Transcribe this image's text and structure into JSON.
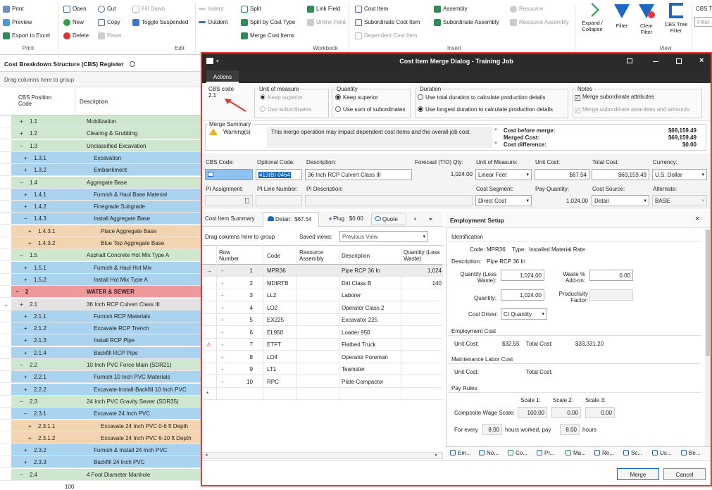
{
  "ribbon": {
    "print": "Print",
    "preview": "Preview",
    "export": "Export to Excel",
    "group_print": "Print",
    "open": "Open",
    "new": "New",
    "delete": "Delete",
    "cut": "Cut",
    "copy": "Copy",
    "paste": "Paste",
    "fill_down": "Fill Down",
    "toggle_suspended": "Toggle Suspended",
    "group_edit": "Edit",
    "indent": "Indent",
    "outdent": "Outdent",
    "split": "Split",
    "split_by_cost_type": "Split by Cost Type",
    "merge_cost_items": "Merge Cost Items",
    "link_field": "Link Field",
    "unlink_field": "Unlink Field",
    "group_workbook": "Workbook",
    "cost_item": "Cost Item",
    "subordinate_cost_item": "Subordinate Cost Item",
    "dependent_cost_item": "Dependent Cost Item",
    "assembly": "Assembly",
    "subordinate_assembly": "Subordinate Assembly",
    "resource": "Resource",
    "resource_assembly": "Resource Assembly",
    "group_insert": "Insert",
    "expand_collapse": "Expand / Collapse",
    "filter": "Filter",
    "clear_filter": "Clear Filter",
    "cbs_tree_filter": "CBS Tree Filter",
    "group_view": "View",
    "cbs_tr": "CBS Tr",
    "filter_input": "Filter"
  },
  "left_panel": {
    "title": "Cost Breakdown Structure (CBS) Register",
    "drag_hint": "Drag columns here to group",
    "col_code": "CBS Position Code",
    "col_desc": "Description",
    "footer_count": "100",
    "rows": [
      {
        "sign": "+",
        "code": "1.1",
        "desc": "Mobilization",
        "color": "green"
      },
      {
        "sign": "+",
        "code": "1.2",
        "desc": "Clearing & Grubbing",
        "color": "green"
      },
      {
        "sign": "−",
        "code": "1.3",
        "desc": "Unclassified Excavation",
        "color": "green"
      },
      {
        "sign": "+",
        "code": "1.3.1",
        "desc": "Excavation",
        "color": "blue"
      },
      {
        "sign": "+",
        "code": "1.3.2",
        "desc": "Embankment",
        "color": "blue"
      },
      {
        "sign": "−",
        "code": "1.4",
        "desc": "Aggregate Base",
        "color": "green"
      },
      {
        "sign": "+",
        "code": "1.4.1",
        "desc": "Furnish & Haul Base Material",
        "color": "blue"
      },
      {
        "sign": "+",
        "code": "1.4.2",
        "desc": "Finegrade Subgrade",
        "color": "blue"
      },
      {
        "sign": "−",
        "code": "1.4.3",
        "desc": "Install Aggregate Base",
        "color": "blue"
      },
      {
        "sign": "+",
        "code": "1.4.3.1",
        "desc": "Place Aggregate Base",
        "color": "orange"
      },
      {
        "sign": "+",
        "code": "1.4.3.2",
        "desc": "Blue Top Aggregate Base",
        "color": "orange"
      },
      {
        "sign": "−",
        "code": "1.5",
        "desc": "Asphalt Concrete Hot Mix Type A",
        "color": "green"
      },
      {
        "sign": "+",
        "code": "1.5.1",
        "desc": "Furnish & Haul Hot Mix",
        "color": "blue"
      },
      {
        "sign": "+",
        "code": "1.5.2",
        "desc": "Install Hot Mix Type A",
        "color": "blue"
      },
      {
        "sign": "−",
        "code": "2",
        "desc": "WATER & SEWER",
        "color": "red"
      },
      {
        "sign": "+",
        "code": "2.1",
        "desc": "36 Inch RCP Culvert Class III",
        "color": "gray",
        "current": true
      },
      {
        "sign": "+",
        "code": "2.1.1",
        "desc": "Furnish RCP Materials",
        "color": "blue"
      },
      {
        "sign": "+",
        "code": "2.1.2",
        "desc": "Excavate RCP Trench",
        "color": "blue"
      },
      {
        "sign": "+",
        "code": "2.1.3",
        "desc": "Install RCP Pipe",
        "color": "blue"
      },
      {
        "sign": "+",
        "code": "2.1.4",
        "desc": "Backfill RCP Pipe",
        "color": "blue"
      },
      {
        "sign": "−",
        "code": "2.2",
        "desc": "10 Inch PVC Force Main (SDR21)",
        "color": "green"
      },
      {
        "sign": "+",
        "code": "2.2.1",
        "desc": "Furnish 10 Inch PVC Materials",
        "color": "blue"
      },
      {
        "sign": "+",
        "code": "2.2.2",
        "desc": "Excavate-Install-Backfill 10 Inch PVC",
        "color": "blue"
      },
      {
        "sign": "−",
        "code": "2.3",
        "desc": "24 Inch PVC Gravity Sewer (SDR35)",
        "color": "green"
      },
      {
        "sign": "−",
        "code": "2.3.1",
        "desc": "Excavate 24 Inch PVC",
        "color": "blue"
      },
      {
        "sign": "+",
        "code": "2.3.1.1",
        "desc": "Excavate 24 Inch PVC 0-6 ft Depth",
        "color": "orange"
      },
      {
        "sign": "+",
        "code": "2.3.1.2",
        "desc": "Excavate 24 Inch PVC 6-10 ft Depth",
        "color": "orange"
      },
      {
        "sign": "+",
        "code": "2.3.2",
        "desc": "Furnish & Install 24 Inch PVC",
        "color": "blue"
      },
      {
        "sign": "+",
        "code": "2.3.3",
        "desc": "Backfill 24 Inch PVC",
        "color": "blue"
      },
      {
        "sign": "−",
        "code": "2.4",
        "desc": "4 Foot Diameter Manhole",
        "color": "green"
      }
    ]
  },
  "dialog": {
    "title": "Cost Item Merge Dialog - Training Job",
    "actions_tab": "Actions",
    "cbs_code_label": "CBS code",
    "cbs_code_value": "2.1",
    "uom_label": "Unit of measure",
    "uom_keep_superior": "Keep superior",
    "uom_use_subordinates": "Use subordinates",
    "qty_label": "Quantity",
    "qty_keep_superior": "Keep superior",
    "qty_use_sum": "Use sum of subordinates",
    "duration_label": "Duration",
    "dur_total": "Use total duration to calculate production details",
    "dur_longest": "Use longest duration to calculate production details",
    "notes_label": "Notes",
    "notes_merge_attr": "Merge subordinate attributes",
    "notes_merge_awardees": "Merge subordinate awardees and amounts",
    "merge_summary_label": "Merge Summary",
    "warnings": "Warning(s)",
    "warning_msg": "This merge operation may impact dependent cost items and the overall job cost.",
    "cost_before_label": "Cost before merge:",
    "cost_before": "$69,159.49",
    "merged_cost_label": "Merged Cost:",
    "merged_cost": "$69,159.49",
    "cost_diff_label": "Cost difference:",
    "cost_diff": "$0.00",
    "f_cbs_code": "CBS Code:",
    "f_optional_code": "Optional Code:",
    "f_optional_code_val": "413(B) 0464",
    "f_description": "Description:",
    "f_description_val": "36 Inch RCP Culvert Class III",
    "f_forecast_qty": "Forecast (T/O) Qty:",
    "f_forecast_qty_val": "1,024.00",
    "f_uom": "Unit of Measure:",
    "f_uom_val": "Linear Feet",
    "f_unit_cost": "Unit Cost:",
    "f_unit_cost_val": "$67.54",
    "f_total_cost": "Total Cost:",
    "f_total_cost_val": "$69,159.49",
    "f_currency": "Currency:",
    "f_currency_val": "U.S. Dollar",
    "f_pi_assignment": "PI Assignment:",
    "f_pi_line": "PI Line Number:",
    "f_pi_desc": "PI Description:",
    "f_cost_segment": "Cost Segment:",
    "f_cost_segment_val": "Direct Cost",
    "f_pay_qty": "Pay Quantity:",
    "f_pay_qty_val": "1,024.00",
    "f_cost_source": "Cost Source:",
    "f_cost_source_val": "Detail",
    "f_alternate": "Alternate:",
    "f_alternate_val": "BASE",
    "tabs": [
      "Cost Item Summary",
      "Detail : $67.54",
      "Plug : $0.00",
      "Quote"
    ],
    "grid_drag_hint": "Drag columns here to group",
    "saved_views_label": "Saved views:",
    "saved_views_val": "Previous View",
    "grid_cols": [
      "Row Number",
      "Code",
      "Resource Assembly",
      "Description",
      "Quantity (Less Waste)"
    ],
    "grid_rows": [
      {
        "n": "1",
        "code": "MPR36",
        "desc": "Pipe RCP 36 In",
        "qty": "1,024"
      },
      {
        "n": "2",
        "code": "MDIRTB",
        "desc": "Dirt Class B",
        "qty": "140"
      },
      {
        "n": "3",
        "code": "LL2",
        "desc": "Laborer",
        "qty": ""
      },
      {
        "n": "4",
        "code": "LO2",
        "desc": "Operator Class 2",
        "qty": ""
      },
      {
        "n": "5",
        "code": "EX225",
        "desc": "Excavator 225",
        "qty": ""
      },
      {
        "n": "6",
        "code": "EL950",
        "desc": "Loader 950",
        "qty": ""
      },
      {
        "n": "7",
        "code": "ETFT",
        "desc": "Flatbed Truck",
        "qty": ""
      },
      {
        "n": "8",
        "code": "LO4",
        "desc": "Operator Foreman",
        "qty": ""
      },
      {
        "n": "9",
        "code": "LT1",
        "desc": "Teamster",
        "qty": ""
      },
      {
        "n": "10",
        "code": "RPC",
        "desc": "Plate Compactor",
        "qty": ""
      }
    ],
    "emp": {
      "title": "Employment Setup",
      "identification": "Identification",
      "code_label": "Code:",
      "code_val": "MPR36",
      "type_label": "Type:",
      "type_val": "Installed Material Rate",
      "desc_label": "Description:",
      "desc_val": "Pipe RCP 36 In",
      "qty_less_waste": "Quantity (Less Waste):",
      "qty_less_waste_val": "1,024.00",
      "waste_label": "Waste % Add-on:",
      "waste_val": "0.00",
      "quantity_label": "Quantity:",
      "quantity_val": "1,024.00",
      "prod_factor": "Productivity Factor:",
      "cost_driver": "Cost Driver:",
      "cost_driver_val": "CI Quantity",
      "employment_cost": "Employment Cost",
      "unit_cost_label": "Unit Cost:",
      "unit_cost_val": "$32.55",
      "total_cost_label": "Total Cost:",
      "total_cost_val": "$33,331.20",
      "maint_labor": "Maintenance Labor Cost",
      "maint_unit_cost": "Unit Cost:",
      "maint_total_cost": "Total Cost:",
      "pay_rules": "Pay Rules",
      "scale1": "Scale 1:",
      "scale2": "Scale 2:",
      "scale3": "Scale 3:",
      "comp_wage": "Composite Wage Scale:",
      "s1": "100.00",
      "s2": "0.00",
      "s3": "0.00",
      "for_every": "For every",
      "for_every_val": "8.00",
      "hours_worked_pay": "hours worked, pay",
      "pay_val": "8.00",
      "hours": "hours",
      "bottom_tabs": [
        "Em...",
        "No...",
        "Co...",
        "Pr...",
        "Ma...",
        "Re...",
        "Sc...",
        "Us...",
        "Be..."
      ]
    },
    "merge_btn": "Merge",
    "cancel_btn": "Cancel"
  },
  "colors": {
    "green": "#cfe7cf",
    "blue": "#a9d3ee",
    "orange": "#f2d5b0",
    "red": "#ef9a9a",
    "gray": "#e3e3e3",
    "dialog_border": "#e53935",
    "titlebar": "#2b2b2b",
    "selection": "#0b64c5"
  }
}
